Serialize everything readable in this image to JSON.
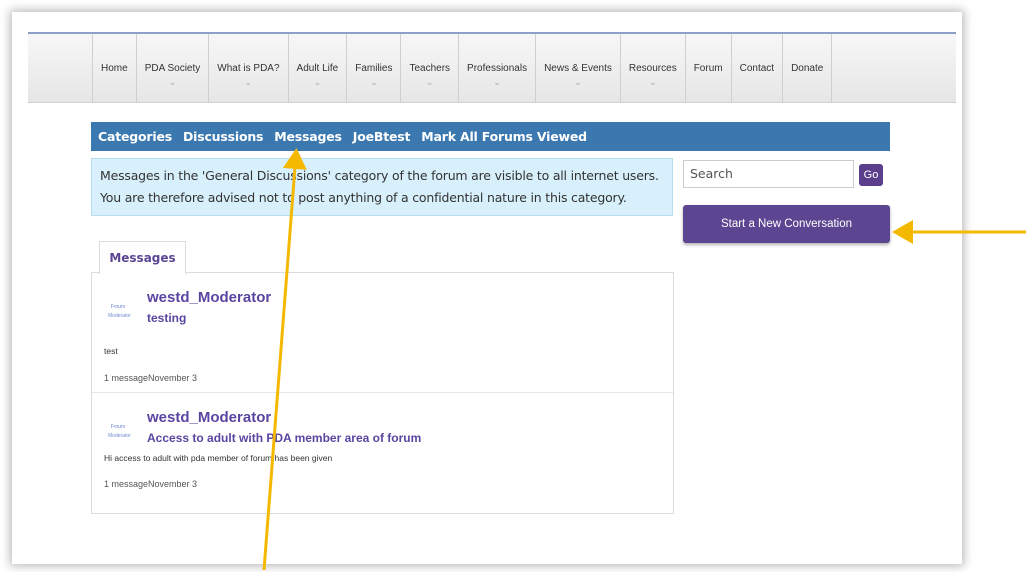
{
  "nav": {
    "items": [
      {
        "label": "Home",
        "dropdown": false
      },
      {
        "label": "PDA Society",
        "dropdown": true
      },
      {
        "label": "What is PDA?",
        "dropdown": true
      },
      {
        "label": "Adult Life",
        "dropdown": true
      },
      {
        "label": "Families",
        "dropdown": true
      },
      {
        "label": "Teachers",
        "dropdown": true
      },
      {
        "label": "Professionals",
        "dropdown": true
      },
      {
        "label": "News & Events",
        "dropdown": true
      },
      {
        "label": "Resources",
        "dropdown": true
      },
      {
        "label": "Forum",
        "dropdown": false
      },
      {
        "label": "Contact",
        "dropdown": false
      },
      {
        "label": "Donate",
        "dropdown": false
      }
    ]
  },
  "catbar": {
    "categories": "Categories",
    "discussions": "Discussions",
    "messages": "Messages",
    "user": "JoeBtest",
    "mark_all": "Mark All Forums Viewed"
  },
  "notice": {
    "line1": "Messages in the 'General Discussions' category of the forum are visible to all internet users.",
    "line2": "You are therefore advised not to post anything of a confidential nature in this category."
  },
  "search": {
    "placeholder": "Search",
    "go_label": "Go"
  },
  "new_conversation_label": "Start a New Conversation",
  "tab_label": "Messages",
  "messages": [
    {
      "badge_line1": "Forum",
      "badge_line2": "Moderator",
      "author": "westd_Moderator",
      "subject": "testing",
      "snippet": "test",
      "meta": "1 messageNovember 3"
    },
    {
      "badge_line1": "Forum",
      "badge_line2": "Moderator",
      "author": "westd_Moderator",
      "subject": "Access to adult with PDA member area of forum",
      "snippet": "Hi access to adult with pda member of forum has been given",
      "meta": "1 messageNovember 3"
    }
  ],
  "colors": {
    "catbar": "#3c78b0",
    "notice_bg": "#d7f0fb",
    "button_purple": "#5d4691",
    "link_purple": "#5a45a0",
    "arrow": "#f5b800"
  }
}
